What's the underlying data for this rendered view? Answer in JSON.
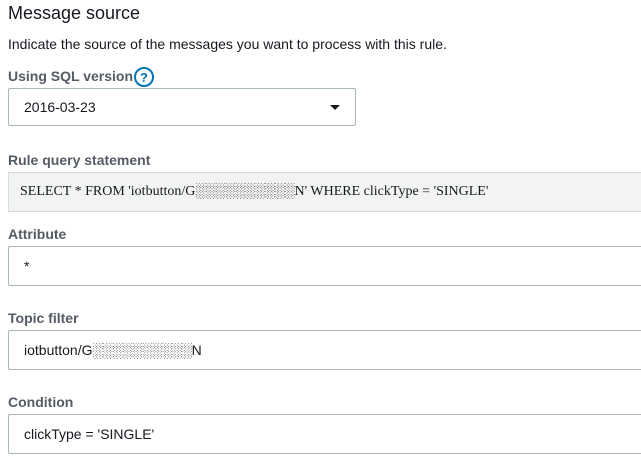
{
  "section": {
    "title": "Message source",
    "description": "Indicate the source of the messages you want to process with this rule."
  },
  "sql_version": {
    "label": "Using SQL version",
    "help_icon": "help-circle-icon",
    "value": "2016-03-23"
  },
  "rule_query": {
    "label": "Rule query statement",
    "value": "SELECT * FROM 'iotbutton/G░░░░░░░░░░N' WHERE clickType = 'SINGLE'"
  },
  "attribute": {
    "label": "Attribute",
    "value": "*"
  },
  "topic_filter": {
    "label": "Topic filter",
    "value": "iotbutton/G░░░░░░░░░░N"
  },
  "condition": {
    "label": "Condition",
    "value": "clickType = 'SINGLE'"
  },
  "colors": {
    "accent": "#0073bb",
    "label": "#545b64",
    "border": "#aab7b8"
  }
}
